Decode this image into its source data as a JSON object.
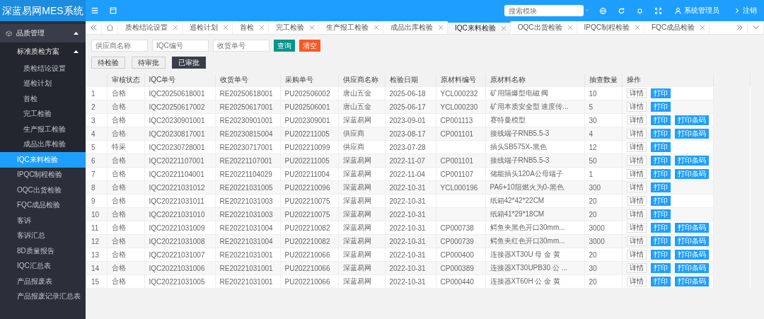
{
  "header": {
    "title": "深蓝易网MES系统",
    "search": {
      "placeholder": "搜索模块"
    },
    "user": "系统管理员",
    "logout": "注销"
  },
  "sidebar": {
    "items": [
      {
        "label": "品质管理",
        "expanded": true,
        "selected": false,
        "children": [
          {
            "label": "标准质检方案",
            "expanded": true,
            "selected": false,
            "children": [
              {
                "label": "质检结论设置",
                "selected": false
              },
              {
                "label": "巡检计划",
                "selected": false
              },
              {
                "label": "首检",
                "selected": false
              },
              {
                "label": "完工检验",
                "selected": false
              },
              {
                "label": "生产报工检验",
                "selected": false
              },
              {
                "label": "成品出库检验",
                "selected": false
              }
            ]
          },
          {
            "label": "IQC来料检验",
            "selected": true
          },
          {
            "label": "IPQC制程检验",
            "selected": false
          },
          {
            "label": "OQC出货检验",
            "selected": false
          },
          {
            "label": "FQC成品检验",
            "selected": false
          },
          {
            "label": "客诉",
            "selected": false
          },
          {
            "label": "客诉汇总",
            "selected": false
          },
          {
            "label": "8D质量报告",
            "selected": false
          },
          {
            "label": "IQC汇总表",
            "selected": false
          },
          {
            "label": "产品报废表",
            "selected": false
          },
          {
            "label": "产品报废记录汇总表",
            "selected": false
          }
        ]
      }
    ]
  },
  "tabs": [
    {
      "label": "质检结论设置",
      "selected": false
    },
    {
      "label": "巡检计划",
      "selected": false
    },
    {
      "label": "首检",
      "selected": false
    },
    {
      "label": "完工检验",
      "selected": false
    },
    {
      "label": "生产报工检验",
      "selected": false
    },
    {
      "label": "成品出库检验",
      "selected": false
    },
    {
      "label": "IQC来料检验",
      "selected": true
    },
    {
      "label": "OQC出货检验",
      "selected": false
    },
    {
      "label": "IPQC制程检验",
      "selected": false
    },
    {
      "label": "FQC成品检验",
      "selected": false
    }
  ],
  "filters": [
    {
      "placeholder": "供应商名称"
    },
    {
      "placeholder": "IQC编号"
    },
    {
      "placeholder": "收货单号"
    }
  ],
  "filter_buttons": [
    {
      "label": "查询",
      "kind": "query"
    },
    {
      "label": "清空",
      "kind": "clear"
    }
  ],
  "status_buttons": [
    {
      "label": "待检验",
      "selected": false
    },
    {
      "label": "待审批",
      "selected": false
    },
    {
      "label": "已审批",
      "selected": true
    }
  ],
  "table": {
    "columns": [
      "",
      "审核状态",
      "IQC单号",
      "收货单号",
      "采购单号",
      "供应商名称",
      "检验日期",
      "原材料编号",
      "原材料名称",
      "抽查数量",
      "操作"
    ],
    "rows": [
      {
        "cells": [
          "1",
          "合格",
          "IQC20250618001",
          "RE20250618001",
          "PU202506002",
          "唐山五金",
          "2025-06-18",
          "YCL000232",
          "矿用隔爆型电磁 阀",
          "10"
        ],
        "actions": [
          "详情",
          "打印"
        ]
      },
      {
        "cells": [
          "2",
          "合格",
          "IQC20250617002",
          "RE20250617001",
          "PU202506001",
          "唐山五金",
          "2025-06-17",
          "YCL000230",
          "矿用本质安全型 速度传...",
          "5"
        ],
        "actions": [
          "详情",
          "打印"
        ]
      },
      {
        "cells": [
          "3",
          "合格",
          "IQC20230901001",
          "RE20230901001",
          "PU202309001",
          "深蓝易网",
          "2023-09-01",
          "CP001113",
          "赛特曼模型",
          "30"
        ],
        "actions": [
          "详情",
          "打印",
          "打印条码"
        ]
      },
      {
        "cells": [
          "4",
          "合格",
          "IQC20230817001",
          "RE20230815004",
          "PU202211005",
          "供应商",
          "2023-08-17",
          "CP001101",
          "接线端子RNB5.5-3",
          "4"
        ],
        "actions": [
          "详情",
          "打印",
          "打印条码"
        ]
      },
      {
        "cells": [
          "5",
          "特采",
          "IQC20230728001",
          "RE20230717001",
          "PU202210099",
          "供应商",
          "2023-07-28",
          "",
          "插头SB575X-黑色",
          "12"
        ],
        "actions": [
          "详情",
          "打印"
        ]
      },
      {
        "cells": [
          "6",
          "合格",
          "IQC20221107001",
          "RE20221107001",
          "PU202211005",
          "深蓝易网",
          "2022-11-07",
          "CP001101",
          "接线端子RNB5.5-3",
          "50"
        ],
        "actions": [
          "详情",
          "打印",
          "打印条码"
        ]
      },
      {
        "cells": [
          "7",
          "合格",
          "IQC20221104001",
          "RE20221104029",
          "PU202211004",
          "深蓝易网",
          "2022-11-04",
          "CP001107",
          "储能插头120A公母端子",
          "1"
        ],
        "actions": [
          "详情",
          "打印",
          "打印条码"
        ]
      },
      {
        "cells": [
          "8",
          "合格",
          "IQC20221031012",
          "RE20221031005",
          "PU202210096",
          "深蓝易网",
          "2022-10-31",
          "YCL000196",
          "PA6+10阻燃火为0-黑色",
          "300"
        ],
        "actions": [
          "详情",
          "打印"
        ]
      },
      {
        "cells": [
          "9",
          "合格",
          "IQC20221031011",
          "RE20221031003",
          "PU202210075",
          "深蓝易网",
          "2022-10-31",
          "",
          "纸箱42*42*22CM",
          "20"
        ],
        "actions": [
          "详情",
          "打印"
        ]
      },
      {
        "cells": [
          "10",
          "合格",
          "IQC20221031010",
          "RE20221031003",
          "PU202210075",
          "深蓝易网",
          "2022-10-31",
          "",
          "纸箱41*29*18CM",
          "20"
        ],
        "actions": [
          "详情",
          "打印"
        ]
      },
      {
        "cells": [
          "11",
          "合格",
          "IQC20221031009",
          "RE20221031004",
          "PU202210082",
          "深蓝易网",
          "2022-10-31",
          "CP000738",
          "鳄鱼夹黑色开口30mm...",
          "3000"
        ],
        "actions": [
          "详情",
          "打印",
          "打印条码"
        ]
      },
      {
        "cells": [
          "12",
          "合格",
          "IQC20221031008",
          "RE20221031004",
          "PU202210082",
          "深蓝易网",
          "2022-10-31",
          "CP000739",
          "鳄鱼夹红色开口30mm...",
          "3000"
        ],
        "actions": [
          "详情",
          "打印",
          "打印条码"
        ]
      },
      {
        "cells": [
          "13",
          "合格",
          "IQC20221031007",
          "RE20221031001",
          "PU202210066",
          "深蓝易网",
          "2022-10-31",
          "CP000400",
          "连接器XT30U 母 金 黄",
          "20"
        ],
        "actions": [
          "详情",
          "打印",
          "打印条码"
        ]
      },
      {
        "cells": [
          "14",
          "合格",
          "IQC20221031006",
          "RE20221031001",
          "PU202210066",
          "深蓝易网",
          "2022-10-31",
          "CP000389",
          "连接器XT30UPB30 公 ...",
          "30"
        ],
        "actions": [
          "详情",
          "打印",
          "打印条码"
        ]
      },
      {
        "cells": [
          "15",
          "合格",
          "IQC20221031005",
          "RE20221031001",
          "PU202210066",
          "深蓝易网",
          "2022-10-31",
          "CP000440",
          "连接器XT60H 公 金 黄",
          "20"
        ],
        "actions": [
          "详情",
          "打印",
          "打印条码"
        ]
      }
    ]
  }
}
